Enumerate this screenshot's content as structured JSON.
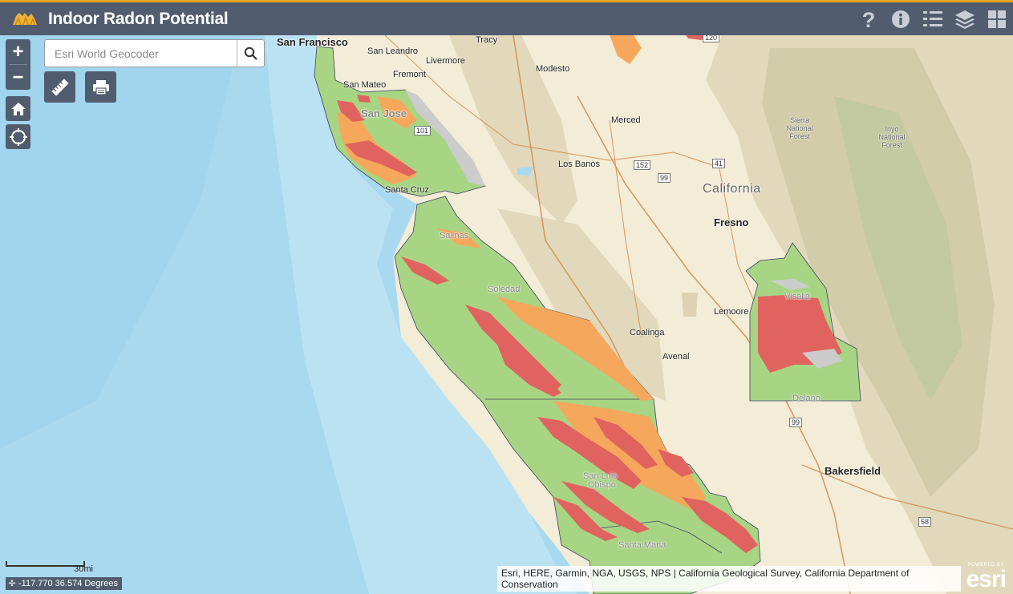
{
  "header": {
    "title": "Indoor Radon Potential",
    "buttons": [
      "help",
      "about",
      "legend",
      "layers",
      "basemap-gallery"
    ]
  },
  "search": {
    "placeholder": "Esri World Geocoder",
    "value": ""
  },
  "scale": {
    "label": "30mi"
  },
  "coordinates": {
    "text": "-117.770 36.574 Degrees"
  },
  "attribution": {
    "text": "Esri, HERE, Garmin, NGA, USGS, NPS | California Geological Survey, California Department of Conservation"
  },
  "esri_logo": {
    "powered": "POWERED BY",
    "word": "esri"
  },
  "colors": {
    "header": "#515d6e",
    "accent": "#f7a21b",
    "low": "#a8d584",
    "moderate": "#f5a85c",
    "high": "#e0635f",
    "nodata": "#cccccc",
    "ocean": "#a9d9ef",
    "land": "#f3ecd6"
  },
  "places": {
    "san_francisco": "San Francisco",
    "san_leandro": "San Leandro",
    "tracy": "Tracy",
    "livermore": "Livermore",
    "modesto": "Modesto",
    "fremont": "Fremont",
    "san_mateo": "San Mateo",
    "san_jose": "San Jose",
    "merced": "Merced",
    "los_banos": "Los Banos",
    "santa_cruz": "Santa Cruz",
    "california": "California",
    "fresno": "Fresno",
    "salinas": "Salinas",
    "soledad": "Soledad",
    "visalia": "Visalia",
    "lemoore": "Lemoore",
    "coalinga": "Coalinga",
    "avenal": "Avenal",
    "delano": "Delano",
    "bakersfield": "Bakersfield",
    "san_luis_obispo_1": "San Luis",
    "san_luis_obispo_2": "Obispo",
    "santa_maria": "Santa Maria",
    "sierra_forest": "Sierra National Forest",
    "inyo_forest": "Inyo National Forest"
  },
  "highways": {
    "h120": "120",
    "h101": "101",
    "h152": "152",
    "h99a": "99",
    "h41": "41",
    "h99b": "99",
    "h58": "58"
  }
}
